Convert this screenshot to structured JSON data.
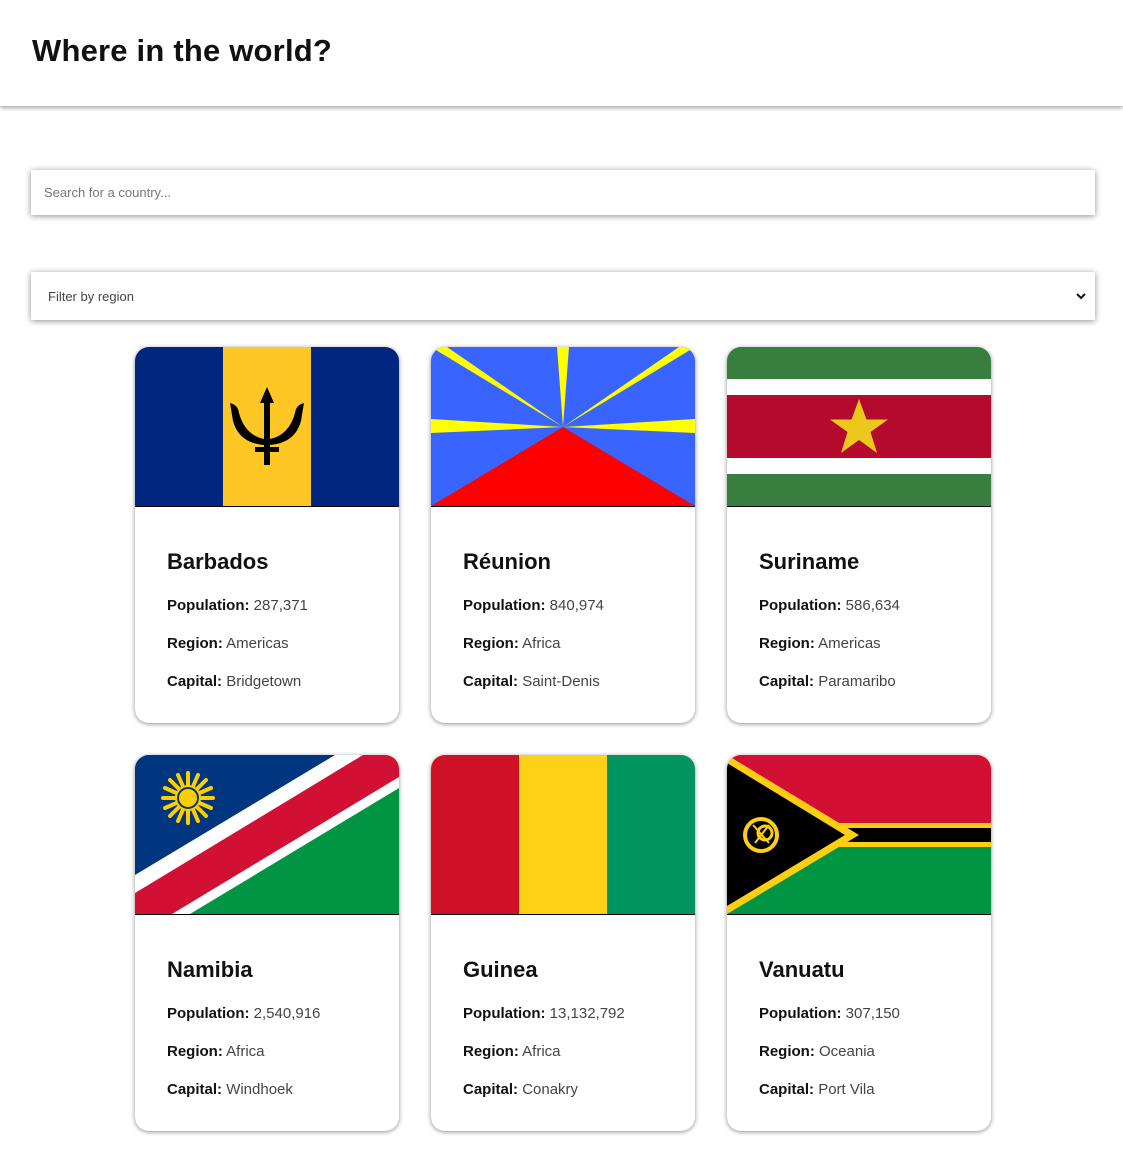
{
  "header": {
    "title": "Where in the world?"
  },
  "search": {
    "placeholder": "Search for a country..."
  },
  "filter": {
    "label": "Filter by region",
    "icon": "chevron-down-icon"
  },
  "labels": {
    "population": "Population:",
    "region": "Region:",
    "capital": "Capital:"
  },
  "countries": [
    {
      "name": "Barbados",
      "population": "287,371",
      "region": "Americas",
      "capital": "Bridgetown"
    },
    {
      "name": "Réunion",
      "population": "840,974",
      "region": "Africa",
      "capital": "Saint-Denis"
    },
    {
      "name": "Suriname",
      "population": "586,634",
      "region": "Americas",
      "capital": "Paramaribo"
    },
    {
      "name": "Namibia",
      "population": "2,540,916",
      "region": "Africa",
      "capital": "Windhoek"
    },
    {
      "name": "Guinea",
      "population": "13,132,792",
      "region": "Africa",
      "capital": "Conakry"
    },
    {
      "name": "Vanuatu",
      "population": "307,150",
      "region": "Oceania",
      "capital": "Port Vila"
    }
  ]
}
